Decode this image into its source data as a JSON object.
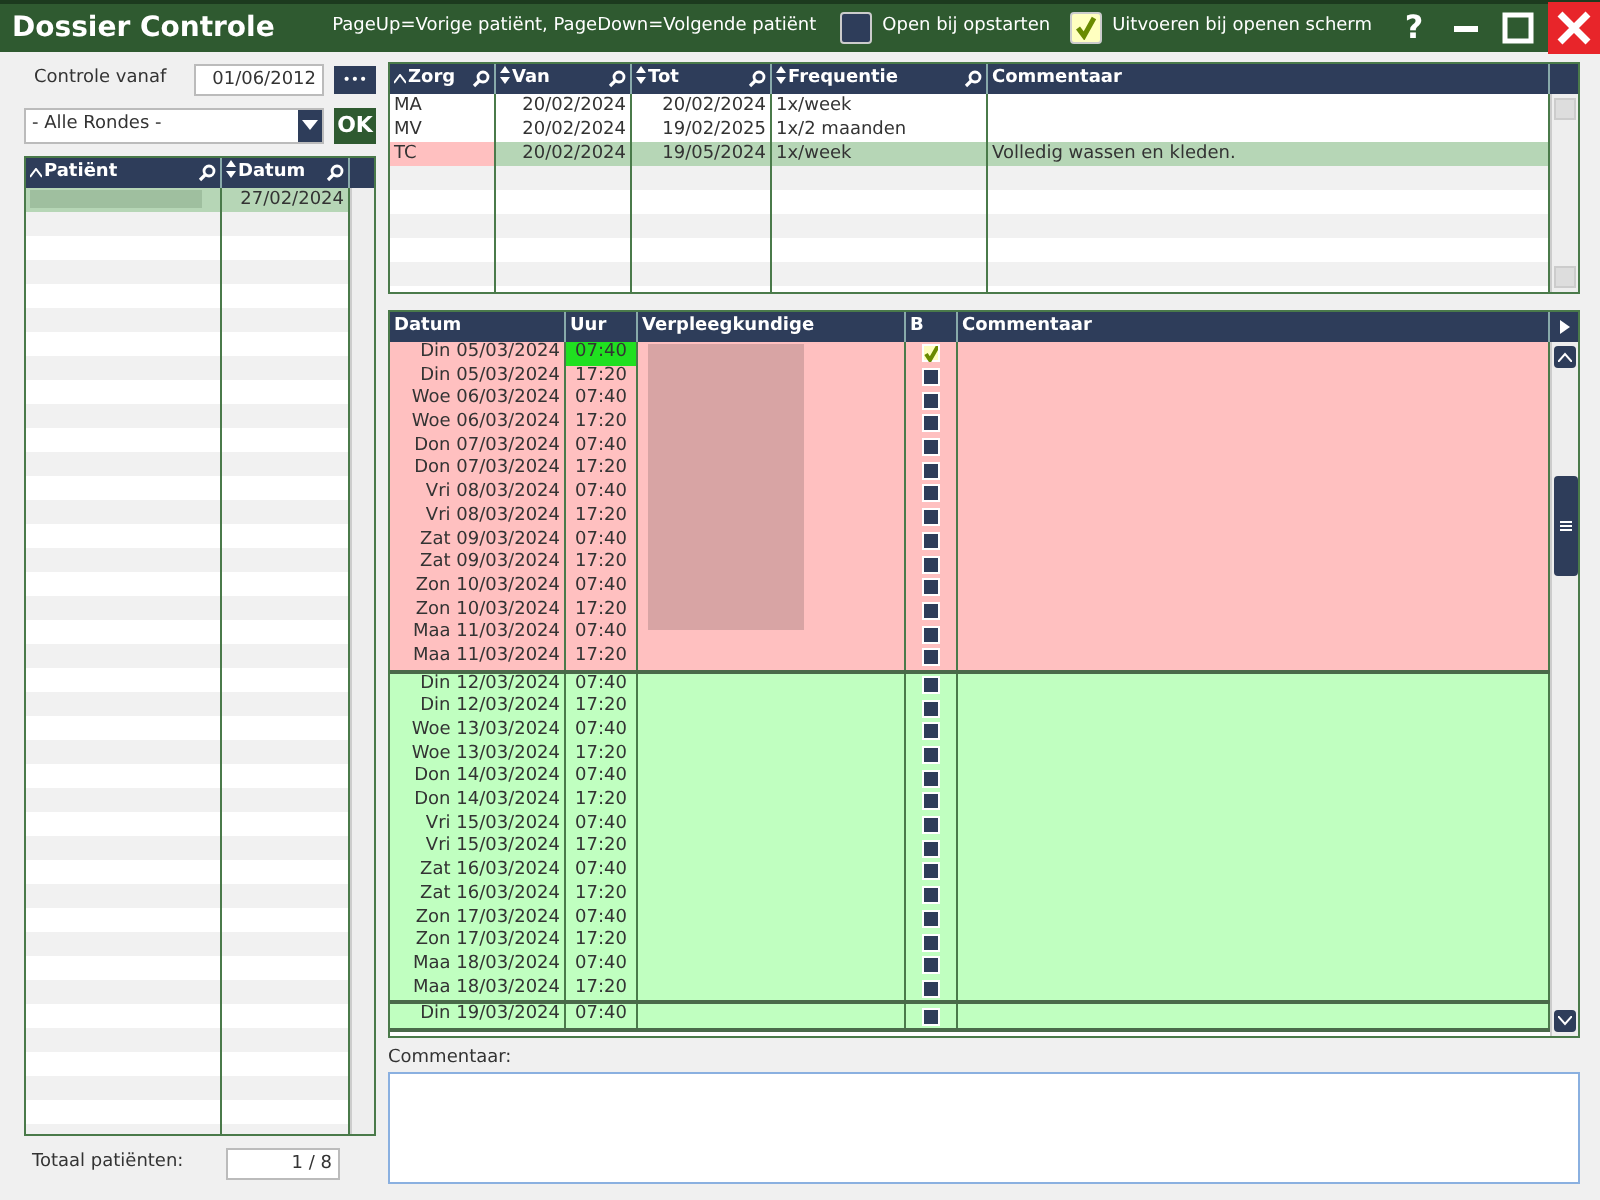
{
  "window": {
    "title": "Dossier Controle",
    "hint": "PageUp=Vorige patiënt, PageDown=Volgende patiënt",
    "help_button": "?"
  },
  "options": [
    {
      "label": "Open bij opstarten",
      "checked": false
    },
    {
      "label": "Uitvoeren bij openen scherm",
      "checked": true
    }
  ],
  "filter": {
    "label": "Controle vanaf",
    "date": "01/06/2012",
    "dots_button": "•••",
    "round_select": "- Alle Rondes -",
    "ok_button": "OK"
  },
  "patients": {
    "columns": [
      {
        "label": "Patiënt",
        "kind": "sorted"
      },
      {
        "label": "Datum",
        "kind": "sortable"
      }
    ],
    "rows": [
      {
        "datum": "27/02/2024",
        "selected": true
      }
    ],
    "total_label": "Totaal patiënten:",
    "total": "1 / 8"
  },
  "care_table": {
    "columns": [
      {
        "label": "Zorg",
        "kind": "sorted"
      },
      {
        "label": "Van",
        "kind": "sortable"
      },
      {
        "label": "Tot",
        "kind": "sortable"
      },
      {
        "label": "Frequentie",
        "kind": "sortable"
      },
      {
        "label": "Commentaar",
        "kind": "plain"
      }
    ],
    "rows": [
      {
        "zorg": "MA",
        "van": "20/02/2024",
        "tot": "20/02/2024",
        "frequentie": "1x/week",
        "selected": false,
        "flagged": false
      },
      {
        "zorg": "MV",
        "van": "20/02/2024",
        "tot": "19/02/2025",
        "frequentie": "1x/2 maanden",
        "selected": false,
        "flagged": false
      },
      {
        "zorg": "TC",
        "van": "20/02/2024",
        "tot": "19/05/2024",
        "frequentie": "1x/week",
        "commentaar": "Volledig wassen en kleden.",
        "selected": true,
        "flagged": true
      }
    ]
  },
  "schedule": {
    "columns": [
      "Datum",
      "Uur",
      "Verpleegkundige",
      "B",
      "Commentaar"
    ],
    "weeks": [
      {
        "color": "#ffc0c0",
        "redacted": true,
        "rows": [
          {
            "datum": "Din 05/03/2024",
            "uur": "07:40",
            "current": true,
            "checked": true
          },
          {
            "datum": "Din 05/03/2024",
            "uur": "17:20",
            "current": false,
            "checked": false
          },
          {
            "datum": "Woe 06/03/2024",
            "uur": "07:40",
            "current": false,
            "checked": false
          },
          {
            "datum": "Woe 06/03/2024",
            "uur": "17:20",
            "current": false,
            "checked": false
          },
          {
            "datum": "Don 07/03/2024",
            "uur": "07:40",
            "current": false,
            "checked": false
          },
          {
            "datum": "Don 07/03/2024",
            "uur": "17:20",
            "current": false,
            "checked": false
          },
          {
            "datum": "Vri 08/03/2024",
            "uur": "07:40",
            "current": false,
            "checked": false
          },
          {
            "datum": "Vri 08/03/2024",
            "uur": "17:20",
            "current": false,
            "checked": false
          },
          {
            "datum": "Zat 09/03/2024",
            "uur": "07:40",
            "current": false,
            "checked": false
          },
          {
            "datum": "Zat 09/03/2024",
            "uur": "17:20",
            "current": false,
            "checked": false
          },
          {
            "datum": "Zon 10/03/2024",
            "uur": "07:40",
            "current": false,
            "checked": false
          },
          {
            "datum": "Zon 10/03/2024",
            "uur": "17:20",
            "current": false,
            "checked": false
          },
          {
            "datum": "Maa 11/03/2024",
            "uur": "07:40",
            "current": false,
            "checked": false
          },
          {
            "datum": "Maa 11/03/2024",
            "uur": "17:20",
            "current": false,
            "checked": false
          }
        ]
      },
      {
        "color": "#c0ffc0",
        "redacted": false,
        "rows": [
          {
            "datum": "Din 12/03/2024",
            "uur": "07:40",
            "current": false,
            "checked": false
          },
          {
            "datum": "Din 12/03/2024",
            "uur": "17:20",
            "current": false,
            "checked": false
          },
          {
            "datum": "Woe 13/03/2024",
            "uur": "07:40",
            "current": false,
            "checked": false
          },
          {
            "datum": "Woe 13/03/2024",
            "uur": "17:20",
            "current": false,
            "checked": false
          },
          {
            "datum": "Don 14/03/2024",
            "uur": "07:40",
            "current": false,
            "checked": false
          },
          {
            "datum": "Don 14/03/2024",
            "uur": "17:20",
            "current": false,
            "checked": false
          },
          {
            "datum": "Vri 15/03/2024",
            "uur": "07:40",
            "current": false,
            "checked": false
          },
          {
            "datum": "Vri 15/03/2024",
            "uur": "17:20",
            "current": false,
            "checked": false
          },
          {
            "datum": "Zat 16/03/2024",
            "uur": "07:40",
            "current": false,
            "checked": false
          },
          {
            "datum": "Zat 16/03/2024",
            "uur": "17:20",
            "current": false,
            "checked": false
          },
          {
            "datum": "Zon 17/03/2024",
            "uur": "07:40",
            "current": false,
            "checked": false
          },
          {
            "datum": "Zon 17/03/2024",
            "uur": "17:20",
            "current": false,
            "checked": false
          },
          {
            "datum": "Maa 18/03/2024",
            "uur": "07:40",
            "current": false,
            "checked": false
          },
          {
            "datum": "Maa 18/03/2024",
            "uur": "17:20",
            "current": false,
            "checked": false
          }
        ]
      },
      {
        "color": "#c0ffc0",
        "redacted": false,
        "rows": [
          {
            "datum": "Din 19/03/2024",
            "uur": "07:40",
            "current": false,
            "checked": false
          }
        ]
      }
    ]
  },
  "comment": {
    "label": "Commentaar:"
  }
}
